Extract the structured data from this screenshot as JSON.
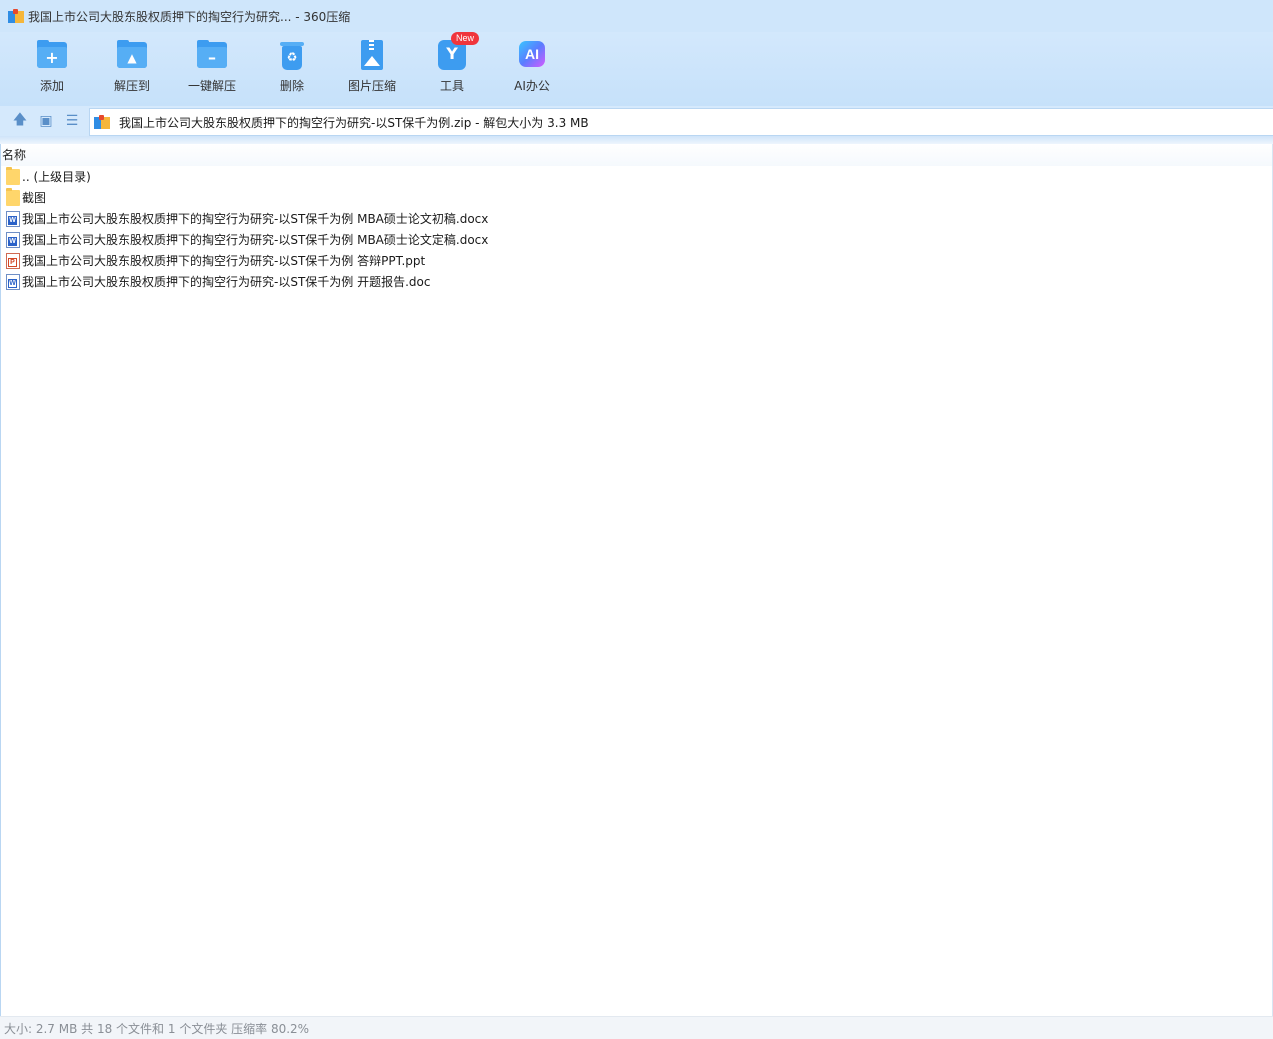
{
  "window": {
    "title": "我国上市公司大股东股权质押下的掏空行为研究... - 360压缩",
    "app_icon": "360zip-app-icon"
  },
  "toolbar": {
    "add_label": "添加",
    "extract_to_label": "解压到",
    "one_click_extract_label": "一键解压",
    "delete_label": "删除",
    "image_compress_label": "图片压缩",
    "tools_label": "工具",
    "tools_badge": "New",
    "ai_office_label": "AI办公",
    "ai_icon_text": "AI",
    "accent_color": "#3d9cf0"
  },
  "addressbar": {
    "path": "我国上市公司大股东股权质押下的掏空行为研究-以ST保千为例.zip - 解包大小为 3.3 MB",
    "icons": [
      "up-arrow-icon",
      "thumbnail-view-icon",
      "list-view-icon"
    ]
  },
  "filelist": {
    "column_name": "名称",
    "rows": [
      {
        "name": ".. (上级目录)",
        "type": "folder"
      },
      {
        "name": "截图",
        "type": "folder"
      },
      {
        "name": "我国上市公司大股东股权质押下的掏空行为研究-以ST保千为例 MBA硕士论文初稿.docx",
        "type": "docx"
      },
      {
        "name": "我国上市公司大股东股权质押下的掏空行为研究-以ST保千为例 MBA硕士论文定稿.docx",
        "type": "docx"
      },
      {
        "name": "我国上市公司大股东股权质押下的掏空行为研究-以ST保千为例 答辩PPT.ppt",
        "type": "ppt"
      },
      {
        "name": "我国上市公司大股东股权质押下的掏空行为研究-以ST保千为例 开题报告.doc",
        "type": "doc"
      }
    ]
  },
  "statusbar": {
    "text": "大小: 2.7 MB 共 18 个文件和 1 个文件夹 压缩率 80.2%"
  }
}
